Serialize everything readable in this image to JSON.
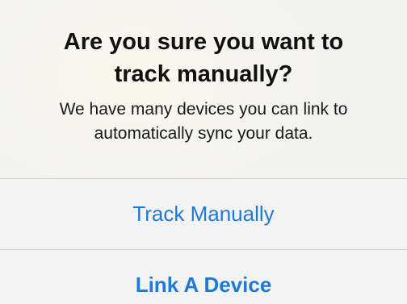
{
  "alert": {
    "title_line1": "Are you sure you want to",
    "title_line2": "track manually?",
    "message_line1": "We have many devices you can link to",
    "message_line2": "automatically sync your data.",
    "actions": {
      "track_manually": "Track Manually",
      "link_device": "Link A Device"
    }
  },
  "colors": {
    "action_text": "#1f7ad6",
    "title_text": "#111111",
    "background": "#f3f3f2",
    "divider": "#d4d4d4"
  }
}
